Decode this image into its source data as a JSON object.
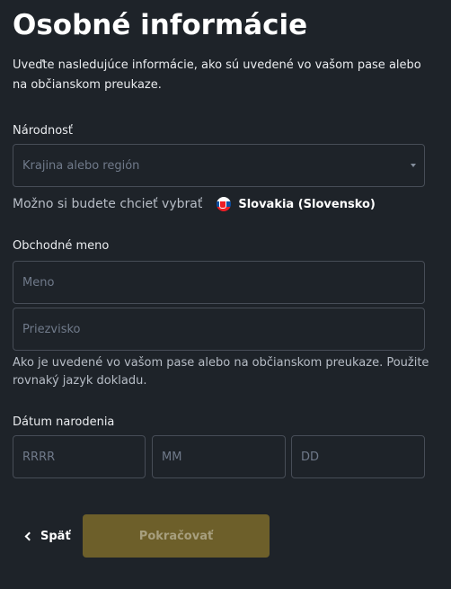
{
  "title": "Osobné informácie",
  "intro": "Uveďte nasledujúce informácie, ako sú uvedené vo vašom pase alebo na občianskom preukaze.",
  "nationality": {
    "label": "Národnosť",
    "placeholder": "Krajina alebo región",
    "suggestion_text": "Možno si budete chcieť vybrať",
    "suggested_country": "Slovakia (Slovensko)",
    "suggested_flag_icon": "slovakia-flag-icon"
  },
  "business_name": {
    "label": "Obchodné meno",
    "first_name_placeholder": "Meno",
    "last_name_placeholder": "Priezvisko",
    "hint": "Ako je uvedené vo vašom pase alebo na občianskom preukaze. Použite rovnaký jazyk dokladu."
  },
  "birth_date": {
    "label": "Dátum narodenia",
    "year_placeholder": "RRRR",
    "month_placeholder": "MM",
    "day_placeholder": "DD"
  },
  "actions": {
    "back_label": "Späť",
    "back_icon": "chevron-left-icon",
    "continue_label": "Pokračovať"
  },
  "colors": {
    "background": "#1e2329",
    "border": "#474d57",
    "continue_disabled": "#6d5f2a"
  }
}
